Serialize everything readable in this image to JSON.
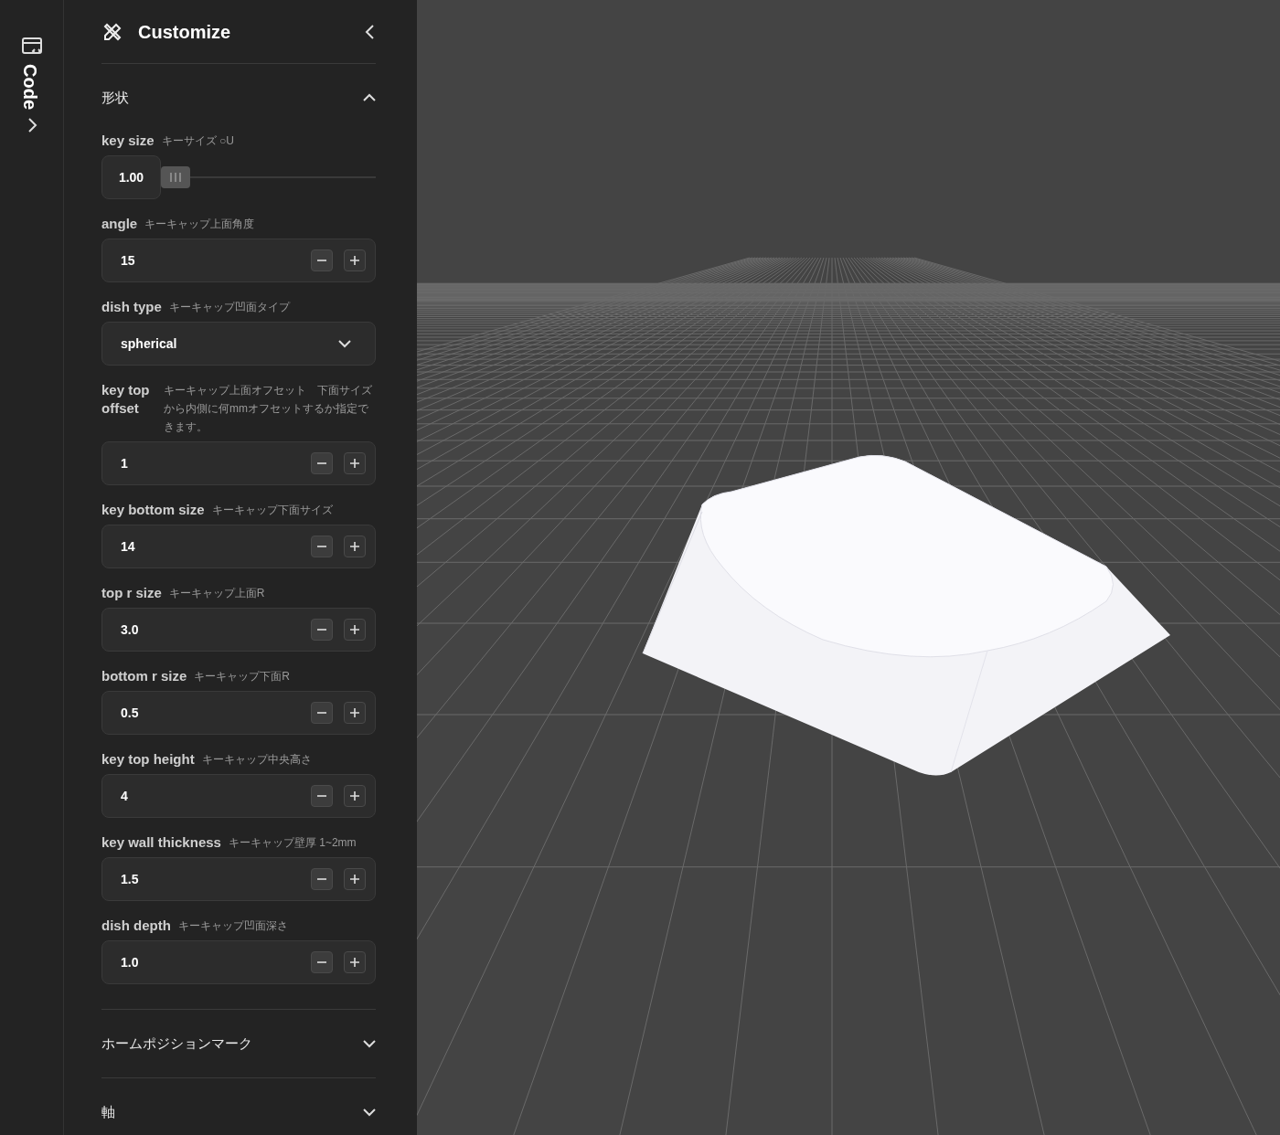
{
  "rail": {
    "label": "Code"
  },
  "panel": {
    "title": "Customize"
  },
  "sections": [
    {
      "title": "形状",
      "expanded": true,
      "fields": [
        {
          "kind": "slider",
          "label": "key size",
          "hint": "キーサイズ ○U",
          "value": "1.00",
          "level": 0
        },
        {
          "kind": "number",
          "label": "angle",
          "hint": "キーキャップ上面角度",
          "value": "15"
        },
        {
          "kind": "select",
          "label": "dish type",
          "hint": "キーキャップ凹面タイプ",
          "value": "spherical"
        },
        {
          "kind": "number",
          "label": "key top offset",
          "hint": "キーキャップ上面オフセット　下面サイズから内側に何mmオフセットするか指定できます。",
          "value": "1"
        },
        {
          "kind": "number",
          "label": "key bottom size",
          "hint": "キーキャップ下面サイズ",
          "value": "14"
        },
        {
          "kind": "number",
          "label": "top r size",
          "hint": "キーキャップ上面R",
          "value": "3.0"
        },
        {
          "kind": "number",
          "label": "bottom r size",
          "hint": "キーキャップ下面R",
          "value": "0.5"
        },
        {
          "kind": "number",
          "label": "key top height",
          "hint": "キーキャップ中央高さ",
          "value": "4"
        },
        {
          "kind": "number",
          "label": "key wall thickness",
          "hint": "キーキャップ壁厚 1~2mm",
          "value": "1.5"
        },
        {
          "kind": "number",
          "label": "dish depth",
          "hint": "キーキャップ凹面深さ",
          "value": "1.0"
        }
      ]
    },
    {
      "title": "ホームポジションマーク",
      "expanded": false
    },
    {
      "title": "軸",
      "expanded": false
    }
  ]
}
